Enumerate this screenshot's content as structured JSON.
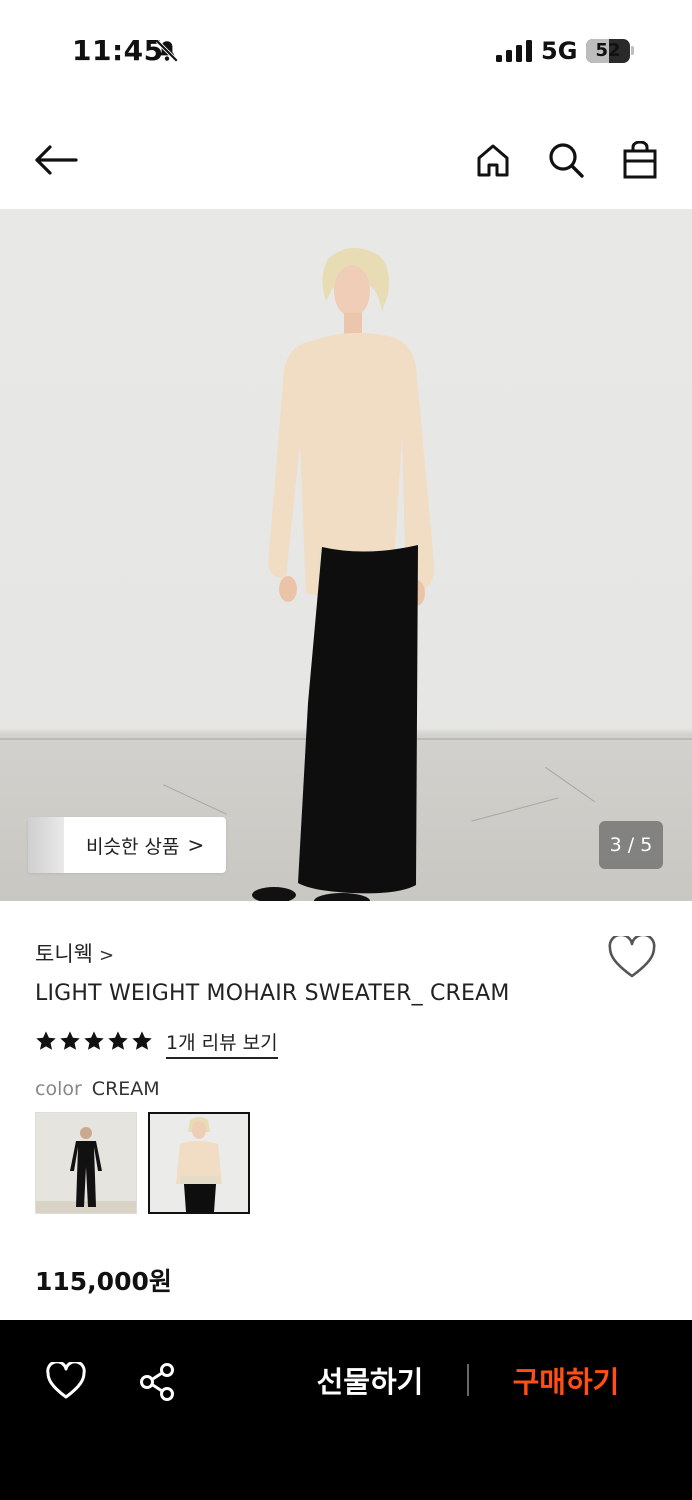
{
  "status_bar": {
    "time": "11:45",
    "network": "5G",
    "battery": "52",
    "battery_level": 0.52
  },
  "header": {
    "back_icon": "arrow-left-icon",
    "home_icon": "home-icon",
    "search_icon": "search-icon",
    "cart_icon": "shopping-bag-icon"
  },
  "gallery": {
    "similar_label": "비슷한 상품",
    "similar_chevron": ">",
    "page_indicator": "3 / 5"
  },
  "product": {
    "brand": "토니웩",
    "brand_chevron": ">",
    "title": "LIGHT WEIGHT MOHAIR SWEATER_ CREAM",
    "rating": 5,
    "review_link": "1개 리뷰 보기",
    "color_label": "color",
    "color_value": "CREAM",
    "price": "115,000원"
  },
  "bottom_bar": {
    "gift_label": "선물하기",
    "buy_label": "구매하기",
    "wish_icon": "heart-icon",
    "share_icon": "share-icon"
  },
  "colors": {
    "accent": "#ff4f16",
    "bar_bg": "#000000"
  }
}
